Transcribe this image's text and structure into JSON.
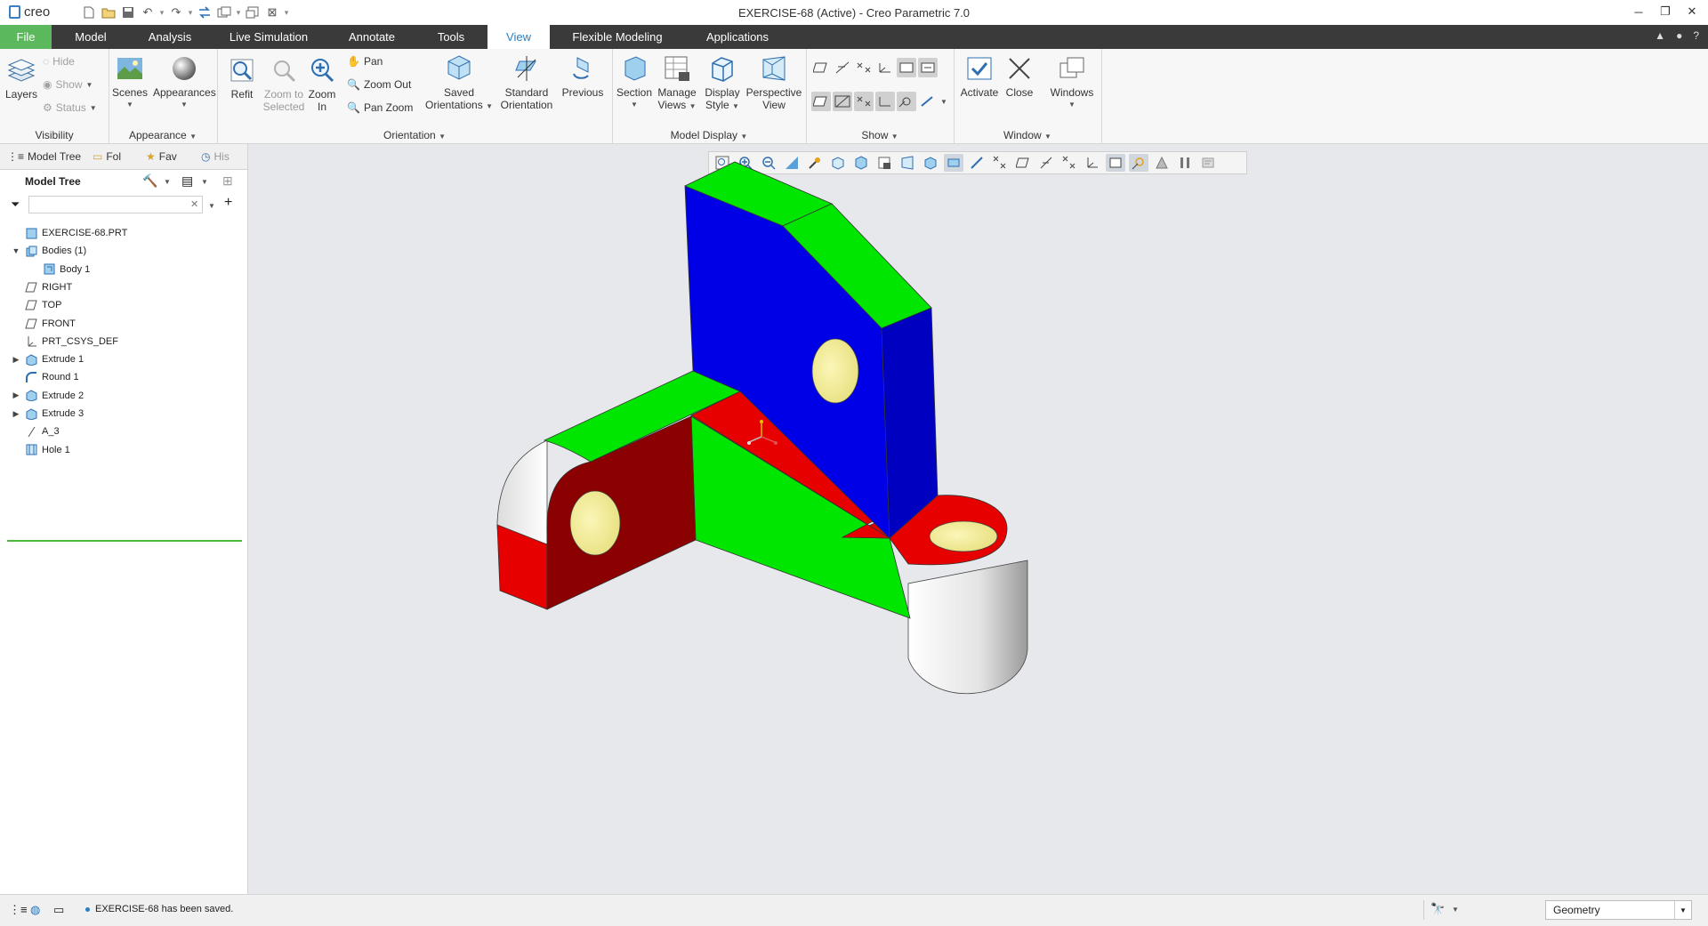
{
  "window": {
    "app_logo": "creo",
    "title": "EXERCISE-68 (Active) - Creo Parametric 7.0",
    "controls": [
      "minimize-icon",
      "restore-icon",
      "close-icon"
    ]
  },
  "menu_tabs": [
    {
      "label": "File"
    },
    {
      "label": "Model"
    },
    {
      "label": "Analysis"
    },
    {
      "label": "Live Simulation"
    },
    {
      "label": "Annotate"
    },
    {
      "label": "Tools"
    },
    {
      "label": "View"
    },
    {
      "label": "Flexible Modeling"
    },
    {
      "label": "Applications"
    }
  ],
  "active_tab": "View",
  "ribbon": {
    "visibility": {
      "label": "Visibility",
      "layers": "Layers",
      "hide": "Hide",
      "show": "Show",
      "status": "Status"
    },
    "appearance": {
      "label": "Appearance",
      "scenes": "Scenes",
      "appearances": "Appearances"
    },
    "orientation": {
      "label": "Orientation",
      "refit": "Refit",
      "zoom_to_selected_1": "Zoom to",
      "zoom_to_selected_2": "Selected",
      "zoom_in_1": "Zoom",
      "zoom_in_2": "In",
      "pan": "Pan",
      "zoom_out": "Zoom Out",
      "pan_zoom": "Pan Zoom",
      "saved_orientations_1": "Saved",
      "saved_orientations_2": "Orientations",
      "standard_orientation_1": "Standard",
      "standard_orientation_2": "Orientation",
      "previous": "Previous"
    },
    "model_display": {
      "label": "Model Display",
      "section": "Section",
      "manage_views_1": "Manage",
      "manage_views_2": "Views",
      "display_style_1": "Display",
      "display_style_2": "Style",
      "perspective_view_1": "Perspective",
      "perspective_view_2": "View"
    },
    "show": {
      "label": "Show"
    },
    "window": {
      "label": "Window",
      "activate": "Activate",
      "close": "Close",
      "windows": "Windows"
    }
  },
  "left_panel": {
    "tabs": [
      {
        "label": "Model Tree"
      },
      {
        "label": "Fol"
      },
      {
        "label": "Fav"
      },
      {
        "label": "His"
      }
    ],
    "header": "Model Tree",
    "filter_placeholder": "",
    "tree": [
      {
        "label": "EXERCISE-68.PRT",
        "icon": "part-icon",
        "level": 0,
        "expander": ""
      },
      {
        "label": "Bodies (1)",
        "icon": "bodies-icon",
        "level": 0,
        "expander": "expanded"
      },
      {
        "label": "Body 1",
        "icon": "body-icon",
        "level": 1,
        "expander": ""
      },
      {
        "label": "RIGHT",
        "icon": "datum-plane-icon",
        "level": 0,
        "expander": ""
      },
      {
        "label": "TOP",
        "icon": "datum-plane-icon",
        "level": 0,
        "expander": ""
      },
      {
        "label": "FRONT",
        "icon": "datum-plane-icon",
        "level": 0,
        "expander": ""
      },
      {
        "label": "PRT_CSYS_DEF",
        "icon": "csys-icon",
        "level": 0,
        "expander": ""
      },
      {
        "label": "Extrude 1",
        "icon": "extrude-icon",
        "level": 0,
        "expander": "collapsed"
      },
      {
        "label": "Round 1",
        "icon": "round-icon",
        "level": 0,
        "expander": ""
      },
      {
        "label": "Extrude 2",
        "icon": "extrude-icon",
        "level": 0,
        "expander": "collapsed"
      },
      {
        "label": "Extrude 3",
        "icon": "extrude-icon",
        "level": 0,
        "expander": "collapsed"
      },
      {
        "label": "A_3",
        "icon": "datum-axis-icon",
        "level": 0,
        "expander": ""
      },
      {
        "label": "Hole 1",
        "icon": "hole-icon",
        "level": 0,
        "expander": ""
      }
    ]
  },
  "status": {
    "message": "EXERCISE-68 has been saved.",
    "selection_filter": "Geometry"
  },
  "colors": {
    "file_tab": "#5cb85c",
    "active_tab_text": "#2a7fc0",
    "model_blue": "#0000e6",
    "model_green": "#00e600",
    "model_red": "#e60000",
    "model_darkred": "#8b0000",
    "hole_yellow": "#f5f0a0",
    "graphics_bg": "#e6e8eb"
  }
}
